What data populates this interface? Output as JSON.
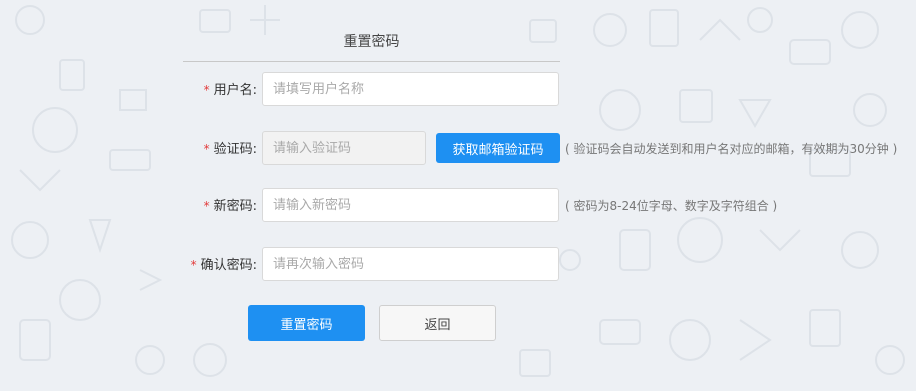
{
  "form": {
    "title": "重置密码",
    "required_mark": "*"
  },
  "fields": {
    "username": {
      "label": "用户名:",
      "placeholder": "请填写用户名称"
    },
    "code": {
      "label": "验证码:",
      "placeholder": "请输入验证码",
      "button_label": "获取邮箱验证码",
      "hint": "( 验证码会自动发送到和用户名对应的邮箱，有效期为30分钟 )"
    },
    "new_password": {
      "label": "新密码:",
      "placeholder": "请输入新密码",
      "hint": "( 密码为8-24位字母、数字及字符组合 )"
    },
    "confirm_password": {
      "label": "确认密码:",
      "placeholder": "请再次输入密码"
    }
  },
  "actions": {
    "reset_label": "重置密码",
    "back_label": "返回"
  },
  "colors": {
    "accent": "#1e90f2",
    "required": "#e23a3a",
    "background": "#edf0f4"
  }
}
